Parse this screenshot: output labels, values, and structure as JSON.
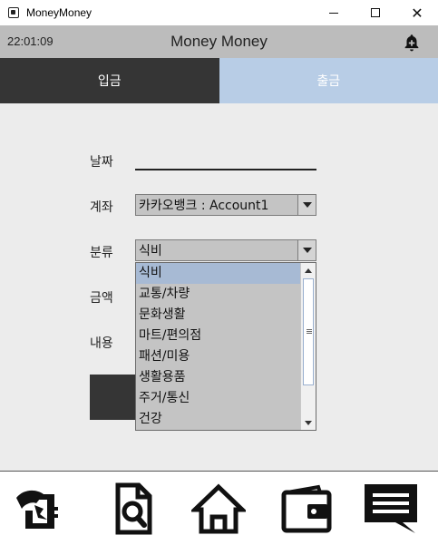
{
  "window": {
    "title": "MoneyMoney",
    "icon": "app-icon",
    "controls": [
      "minimize-icon",
      "maximize-icon",
      "close-icon"
    ],
    "close_glyph": "✕"
  },
  "header": {
    "time": "22:01:09",
    "title": "Money Money",
    "bell_icon": "bell-plus-icon"
  },
  "tabs": [
    {
      "label": "입금",
      "active": false
    },
    {
      "label": "출금",
      "active": true
    }
  ],
  "form": {
    "date_label": "날짜",
    "date_value": "",
    "account_label": "계좌",
    "account_value": "카카오뱅크 : Account1",
    "category_label": "분류",
    "category_value": "식비",
    "amount_label": "금액",
    "memo_label": "내용",
    "category_options": [
      "식비",
      "교통/차량",
      "문화생활",
      "마트/편의점",
      "패션/미용",
      "생활용품",
      "주거/통신",
      "건강"
    ],
    "selected_option": 0
  },
  "bottom_nav": [
    {
      "icon": "income-expense-icon",
      "name": "nav-ledger"
    },
    {
      "icon": "search-document-icon",
      "name": "nav-search"
    },
    {
      "icon": "home-icon",
      "name": "nav-home"
    },
    {
      "icon": "wallet-icon",
      "name": "nav-wallet"
    },
    {
      "icon": "message-icon",
      "name": "nav-messages"
    }
  ],
  "colors": {
    "tab_dark": "#353535",
    "tab_active": "#b8cde6",
    "header_bg": "#bcbcbc",
    "selected_option": "#a7bad4"
  }
}
